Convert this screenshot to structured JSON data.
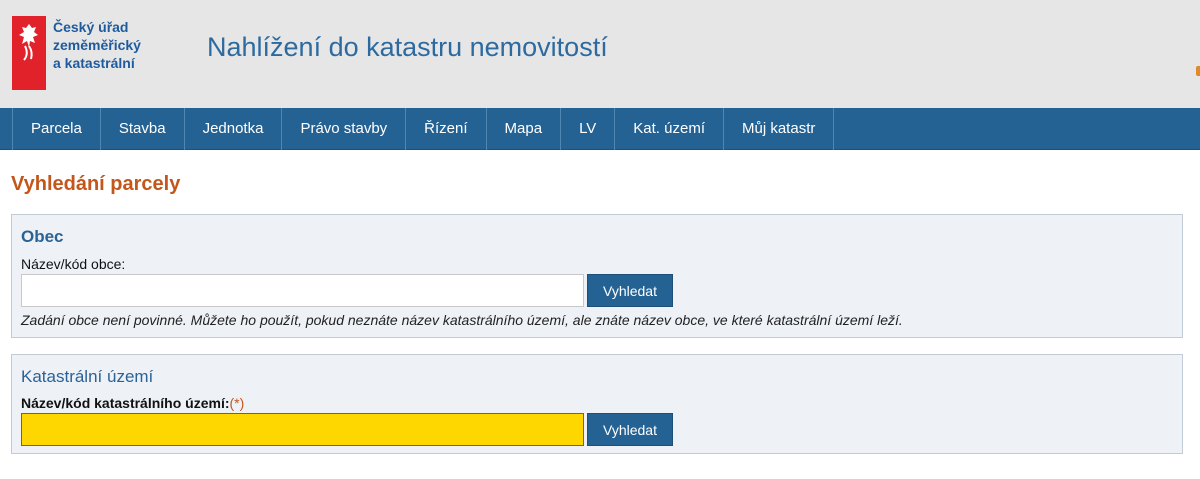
{
  "header": {
    "logo_lines": [
      "Český úřad",
      "zeměměřický",
      "a katastrální"
    ],
    "app_title": "Nahlížení do katastru nemovitostí",
    "emblem_icon": "czech-lion-icon"
  },
  "nav": {
    "items": [
      {
        "label": "Parcela"
      },
      {
        "label": "Stavba"
      },
      {
        "label": "Jednotka"
      },
      {
        "label": "Právo stavby"
      },
      {
        "label": "Řízení"
      },
      {
        "label": "Mapa"
      },
      {
        "label": "LV"
      },
      {
        "label": "Kat. území"
      },
      {
        "label": "Můj katastr"
      }
    ]
  },
  "main": {
    "heading": "Vyhledání parcely",
    "obec": {
      "title": "Obec",
      "field_label": "Název/kód obce:",
      "input_value": "",
      "button_label": "Vyhledat",
      "hint": "Zadání obce není povinné. Můžete ho použít, pokud neznáte název katastrálního území, ale znáte název obce, ve které katastrální území leží."
    },
    "katastralni_uzemi": {
      "title": "Katastrální území",
      "field_label": "Název/kód katastrálního území:",
      "required_mark": "(*)",
      "input_value": "",
      "button_label": "Vyhledat"
    }
  },
  "colors": {
    "nav_bg": "#256294",
    "heading": "#c4561c",
    "brand_red": "#e2222a",
    "required_input_bg": "#ffd700"
  }
}
